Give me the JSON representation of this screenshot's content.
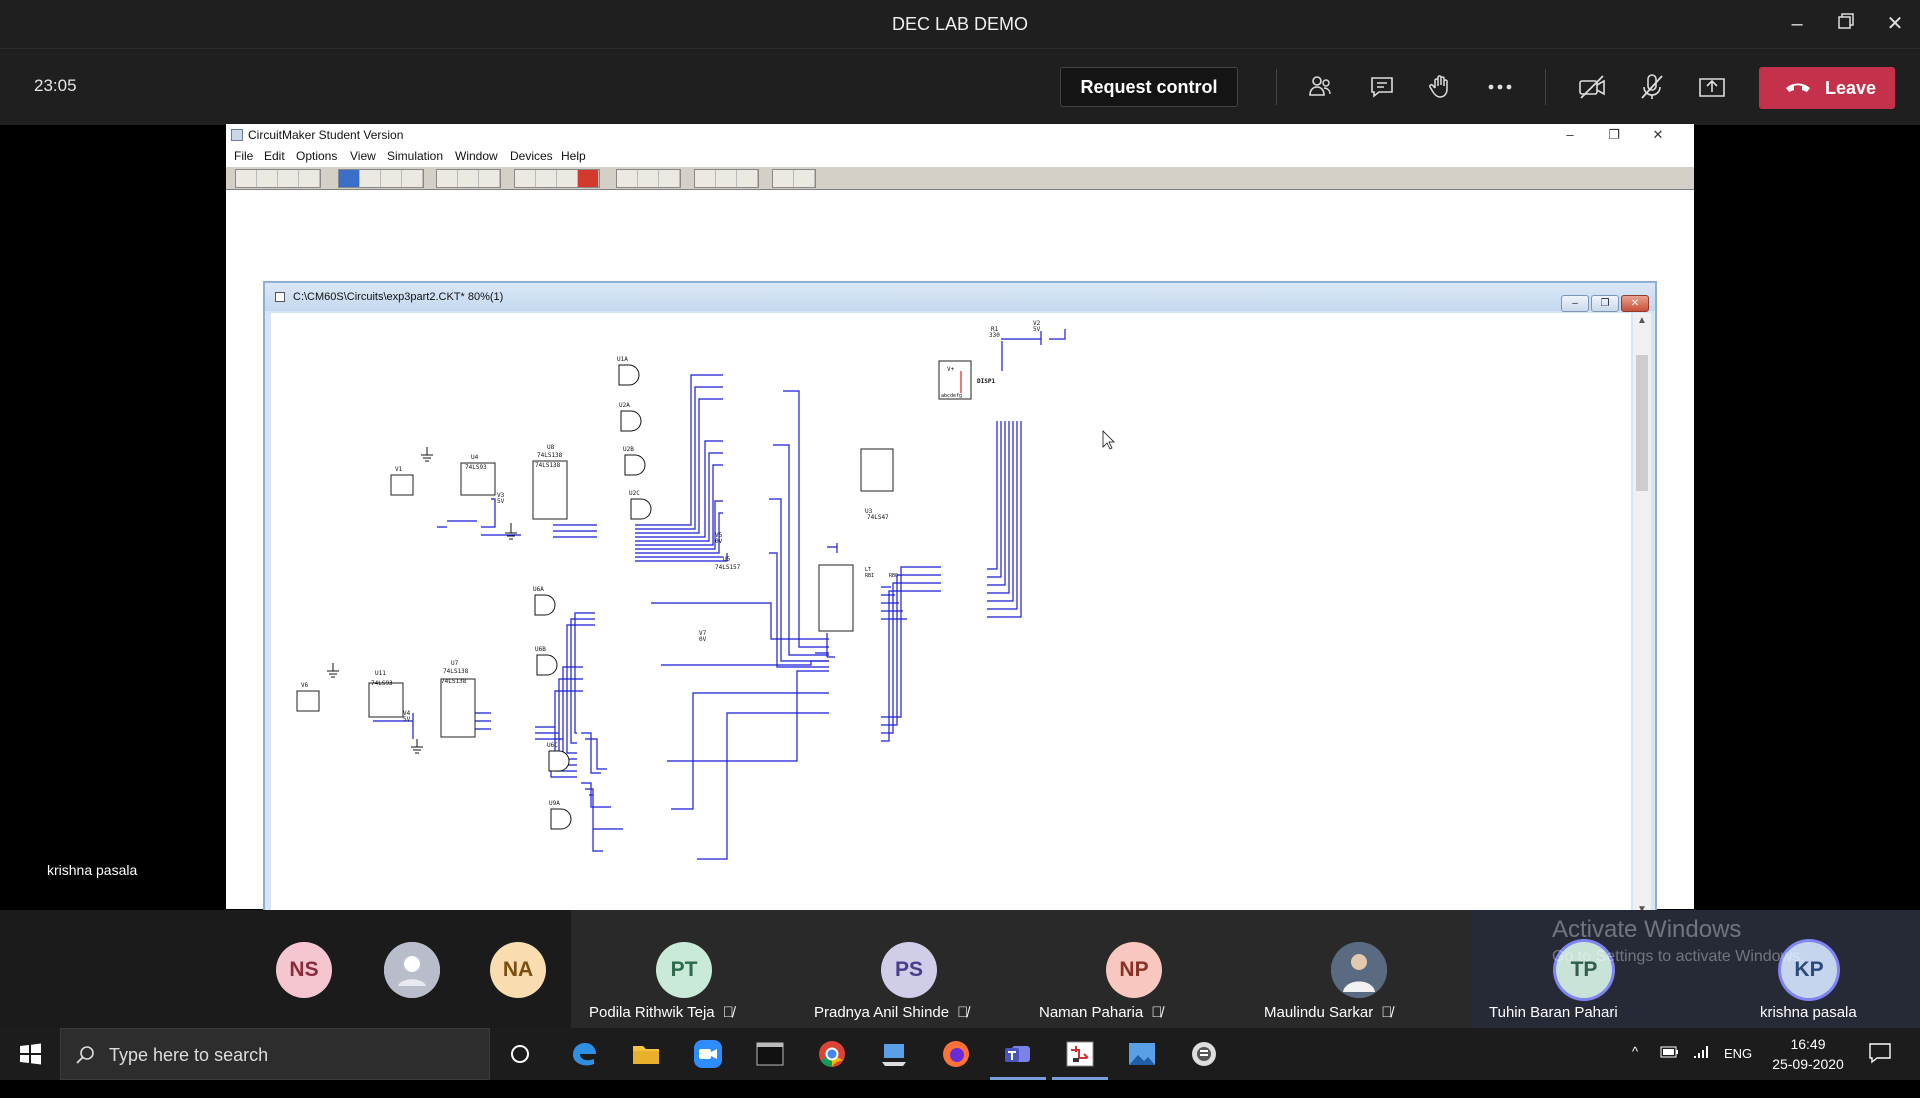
{
  "window": {
    "title": "DEC LAB DEMO"
  },
  "toolbar": {
    "timer": "23:05",
    "request_control_label": "Request control",
    "leave_label": "Leave",
    "colors": {
      "leave": "#c4314b"
    }
  },
  "shared_app": {
    "title": "CircuitMaker Student Version",
    "menu": [
      "File",
      "Edit",
      "Options",
      "View",
      "Simulation",
      "Window",
      "Devices",
      "Help"
    ],
    "document_title": "C:\\CM60S\\Circuits\\exp3part2.CKT* 80%(1)"
  },
  "circuit_labels": {
    "r1": "R1",
    "r1_val": "330",
    "v2": "V2",
    "v2_val": "5V",
    "disp": "DISP1",
    "vplus": "V+",
    "segs": "abcdefg",
    "u1a": "U1A",
    "u2a": "U2A",
    "u2b": "U2B",
    "u2c": "U2C",
    "u4": "U4",
    "u4_part": "74LS93",
    "u8": "U8",
    "u8_part": "74LS138",
    "v1": "V1",
    "v3": "V3",
    "v3_val": "5V",
    "u3": "U3",
    "u3_part": "74LS47",
    "v5": "V5",
    "v5_val": "0V",
    "u5": "U5",
    "u5_part": "74LS157",
    "v7": "V7",
    "v7_val": "0V",
    "u6a": "U6A",
    "u6b": "U6B",
    "u6c": "U6C",
    "u9a": "U9A",
    "u11": "U11",
    "u11_part": "74LS93",
    "u7": "U7",
    "u7_part": "74LS138",
    "v6": "V6",
    "v4": "V4",
    "v4_val": "5V",
    "lt": "LT",
    "rbi": "RBI",
    "rbo": "RBO"
  },
  "presenter_name": "krishna pasala",
  "participants": [
    {
      "initials": "NS",
      "name": "",
      "bg": "#f5c6cf",
      "fg": "#8a2b3c"
    },
    {
      "initials": "",
      "name": "",
      "bg": "#c7c9d6",
      "fg": "#333"
    },
    {
      "initials": "NA",
      "name": "",
      "bg": "#f9dcb0",
      "fg": "#7a4f0e"
    },
    {
      "initials": "PT",
      "name": "Podila Rithwik Teja",
      "bg": "#c9ead9",
      "fg": "#2b6b4c"
    },
    {
      "initials": "PS",
      "name": "Pradnya Anil Shinde",
      "bg": "#cfcde8",
      "fg": "#46408a"
    },
    {
      "initials": "NP",
      "name": "Naman Paharia",
      "bg": "#f7c7c0",
      "fg": "#8a3126"
    },
    {
      "initials": "",
      "name": "Maulindu Sarkar",
      "bg": "#6b7a8c",
      "fg": "#fff"
    },
    {
      "initials": "TP",
      "name": "Tuhin Baran Pahari",
      "bg": "#c9e3d8",
      "fg": "#2e5e4d"
    },
    {
      "initials": "KP",
      "name": "krishna pasala",
      "bg": "#c6d5ee",
      "fg": "#2b4a7a"
    }
  ],
  "watermark": {
    "line1": "Activate Windows",
    "line2": "Go to Settings to activate Windows."
  },
  "taskbar": {
    "search_placeholder": "Type here to search",
    "language": "ENG",
    "time": "16:49",
    "date": "25-09-2020"
  }
}
